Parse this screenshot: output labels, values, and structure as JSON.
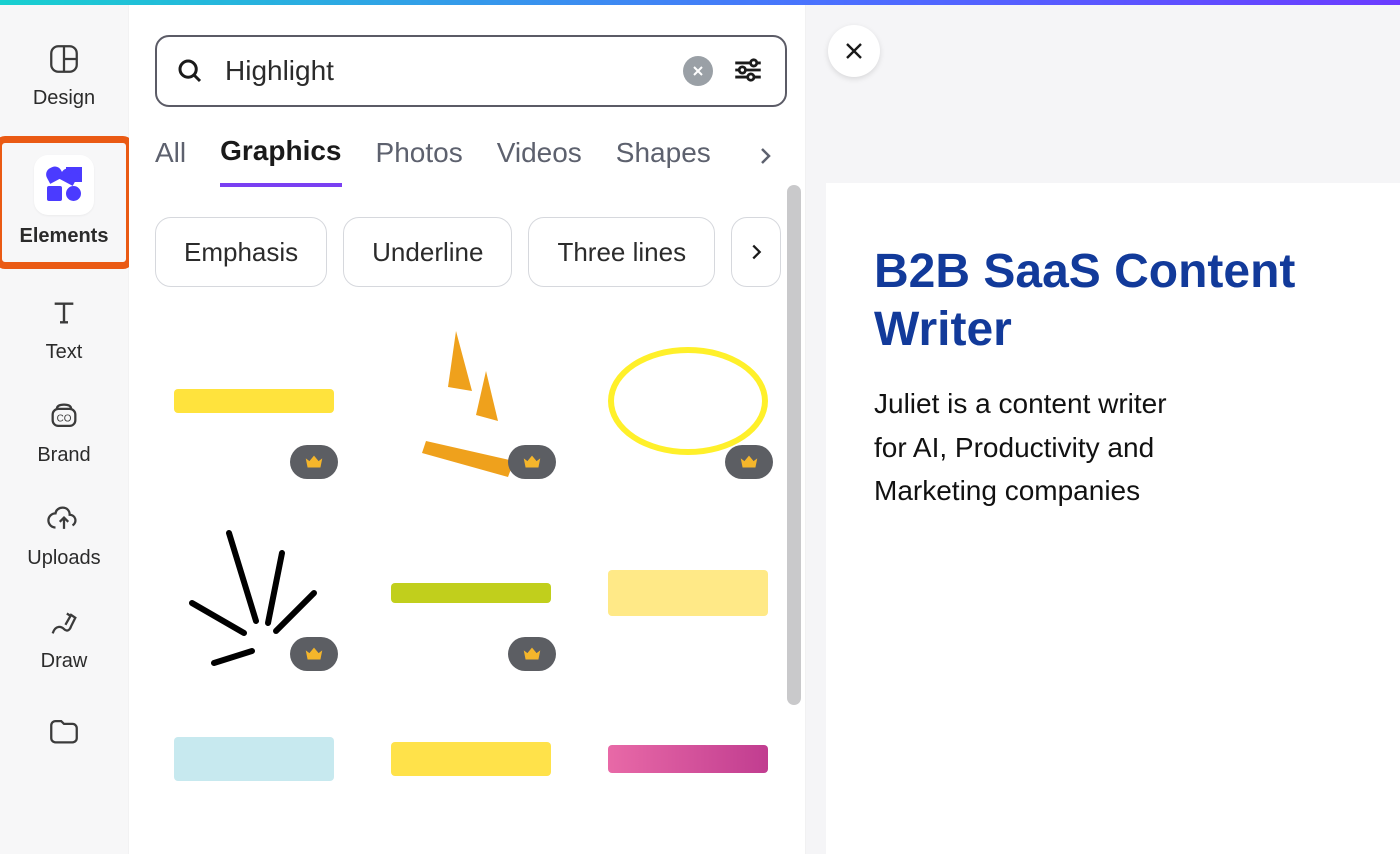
{
  "nav": {
    "design": "Design",
    "elements": "Elements",
    "text": "Text",
    "brand": "Brand",
    "uploads": "Uploads",
    "draw": "Draw"
  },
  "search": {
    "value": "Highlight"
  },
  "tabs": {
    "all": "All",
    "graphics": "Graphics",
    "photos": "Photos",
    "videos": "Videos",
    "shapes": "Shapes"
  },
  "chips": {
    "emphasis": "Emphasis",
    "underline": "Underline",
    "threelines": "Three lines"
  },
  "canvas": {
    "title": "B2B SaaS Content Writer",
    "body": "Juliet is a content writer\n for AI, Productivity and Marketing companies"
  }
}
